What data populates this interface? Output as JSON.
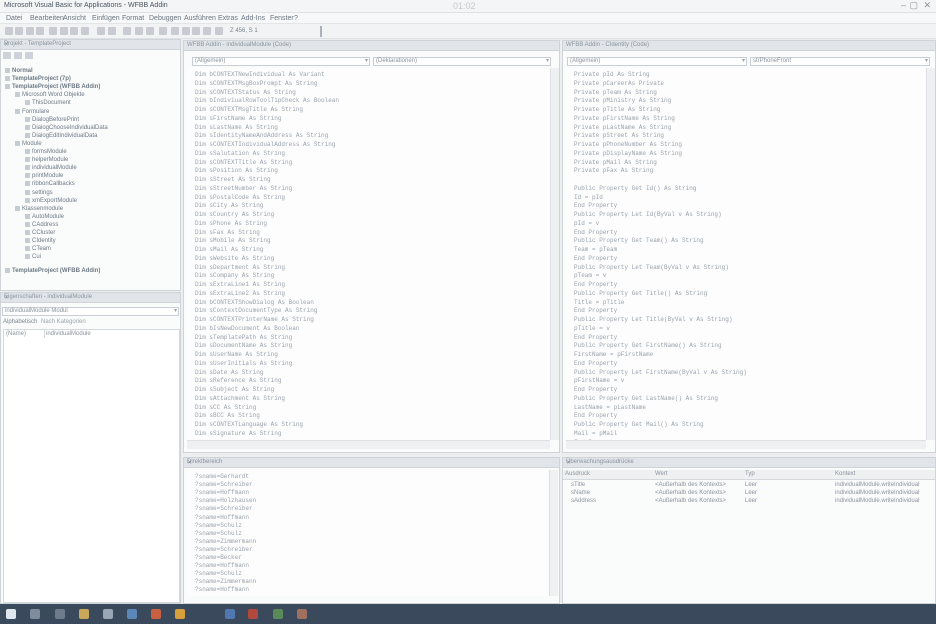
{
  "window": {
    "title": "Microsoft Visual Basic for Applications - WFBB Addin"
  },
  "menu": [
    "Datei",
    "Bearbeiten",
    "Ansicht",
    "Einfügen",
    "Format",
    "Debuggen",
    "Ausführen",
    "Extras",
    "Add-Ins",
    "Fenster",
    "?"
  ],
  "toolbar": {
    "position": "Z 456, S 1"
  },
  "project": {
    "title": "Projekt - TemplateProject",
    "items": [
      {
        "label": "Normal",
        "level": 0
      },
      {
        "label": "TemplateProject (7p)",
        "level": 0
      },
      {
        "label": "TemplateProject (WFBB Addin)",
        "level": 0
      },
      {
        "label": "Microsoft Word Objekte",
        "level": 1
      },
      {
        "label": "ThisDocument",
        "level": 2
      },
      {
        "label": "Formulare",
        "level": 1
      },
      {
        "label": "DialogBeforePrint",
        "level": 2
      },
      {
        "label": "DialogChooseIndividualData",
        "level": 2
      },
      {
        "label": "DialogEditIndividualData",
        "level": 2
      },
      {
        "label": "Module",
        "level": 1
      },
      {
        "label": "formsModule",
        "level": 2
      },
      {
        "label": "helperModule",
        "level": 2
      },
      {
        "label": "individualModule",
        "level": 2
      },
      {
        "label": "printModule",
        "level": 2
      },
      {
        "label": "ribbonCallbacks",
        "level": 2
      },
      {
        "label": "settings",
        "level": 2
      },
      {
        "label": "xmExportModule",
        "level": 2
      },
      {
        "label": "Klassenmodule",
        "level": 1
      },
      {
        "label": "AutoModule",
        "level": 2
      },
      {
        "label": "CAddress",
        "level": 2
      },
      {
        "label": "CCluster",
        "level": 2
      },
      {
        "label": "CIdentity",
        "level": 2
      },
      {
        "label": "CTeam",
        "level": 2
      },
      {
        "label": "Cui",
        "level": 2
      },
      {
        "label": "TemplateProject (WFBB Addin)",
        "level": 0
      }
    ]
  },
  "properties": {
    "title": "Eigenschaften - individualModule",
    "selected": "individualModule Modul",
    "tabs": [
      "Alphabetisch",
      "Nach Kategorien"
    ],
    "row": {
      "name": "(Name)",
      "value": "individualModule"
    }
  },
  "left_code": {
    "title": "WFBB Addin - individualModule (Code)",
    "combo_left": "(Allgemein)",
    "combo_right": "(Deklarationen)",
    "lines": [
      "Dim bCONTEXTNewIndividual As Variant",
      "Dim sCONTEXTMsgBoxPrompt As String",
      "Dim sCONTEXTStatus As String",
      "Dim bIndiviualRowToolTipCheck As Boolean",
      "Dim sCONTEXTMsgTitle As String",
      "Dim sFirstName As String",
      "Dim sLastName As String",
      "Dim sIdentityNameAndAddress As String",
      "Dim sCONTEXTIndividualAddress As String",
      "Dim sSalutation As String",
      "Dim sCONTEXTTitle As String",
      "Dim sPosition As String",
      "Dim sStreet As String",
      "Dim sStreetNumber As String",
      "Dim sPostalCode As String",
      "Dim sCity As String",
      "Dim sCountry As String",
      "Dim sPhone As String",
      "Dim sFax As String",
      "Dim sMobile As String",
      "Dim sMail As String",
      "Dim sWebsite As String",
      "Dim sDepartment As String",
      "Dim sCompany As String",
      "Dim sExtraLine1 As String",
      "Dim sExtraLine2 As String",
      "Dim bCONTEXTShowDialog As Boolean",
      "Dim sContextDocumentType As String",
      "Dim sCONTEXTPrinterName As String",
      "Dim bIsNewDocument As Boolean",
      "Dim sTemplatePath As String",
      "Dim sDocumentName As String",
      "Dim sUserName As String",
      "Dim sUserInitials As String",
      "Dim sDate As String",
      "Dim sReference As String",
      "Dim sSubject As String",
      "Dim sAttachment As String",
      "Dim sCC As String",
      "Dim sBCC As String",
      "Dim sCONTEXTLanguage As String",
      "Dim sSignature As String"
    ]
  },
  "right_code": {
    "title": "WFBB Addin - CIdentity (Code)",
    "combo_left": "(Allgemein)",
    "combo_right": "strPhoneFront",
    "lines": [
      "Private pId As String",
      "Private pCareerAs Private",
      "Private pTeam As String",
      "Private pMinistry As String",
      "Private pTitle As String",
      "Private pFirstName As String",
      "Private pLastName As String",
      "Private pStreet As String",
      "Private pPhoneNumber As String",
      "Private pDisplayName As String",
      "Private pMail As String",
      "Private pFax As String",
      "",
      "Public Property Get Id() As String",
      "    Id = pId",
      "End Property",
      "Public Property Let Id(ByVal v As String)",
      "    pId = v",
      "End Property",
      "Public Property Get Team() As String",
      "    Team = pTeam",
      "End Property",
      "Public Property Let Team(ByVal v As String)",
      "    pTeam = v",
      "End Property",
      "Public Property Get Title() As String",
      "    Title = pTitle",
      "End Property",
      "Public Property Let Title(ByVal v As String)",
      "    pTitle = v",
      "End Property",
      "Public Property Get FirstName() As String",
      "    FirstName = pFirstName",
      "End Property",
      "Public Property Let FirstName(ByVal v As String)",
      "    pFirstName = v",
      "End Property",
      "Public Property Get LastName() As String",
      "    LastName = pLastName",
      "End Property",
      "Public Property Get Mail() As String",
      "    Mail = pMail",
      "End Property"
    ]
  },
  "immediate": {
    "title": "Direktbereich",
    "lines": [
      "?sname=Gerhardt",
      "?sname=Schreiber",
      "?sname=Hoffmann",
      "?sname=Holzhausen",
      "?sname=Schreiber",
      "?sname=Hoffmann",
      "?sname=Schulz",
      "?sname=Schulz",
      "?sname=Zimmermann",
      "?sname=Schreiber",
      "?sname=Becker",
      "?sname=Hoffmann",
      "?sname=Schulz",
      "?sname=Zimmermann",
      "?sname=Hoffmann"
    ]
  },
  "watch": {
    "title": "Überwachungsausdrücke",
    "columns": [
      "Ausdruck",
      "Wert",
      "Typ",
      "Kontext"
    ],
    "rows": [
      [
        "sTitle",
        "<Außerhalb des Kontexts>",
        "Leer",
        "individualModule.writeIndividual"
      ],
      [
        "sName",
        "<Außerhalb des Kontexts>",
        "Leer",
        "individualModule.writeIndividual"
      ],
      [
        "sAddress",
        "<Außerhalb des Kontexts>",
        "Leer",
        "individualModule.writeIndividual"
      ]
    ]
  },
  "clock": "01:02"
}
